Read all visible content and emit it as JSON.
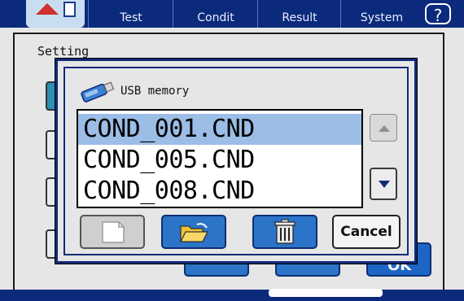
{
  "tabs": [
    {
      "label": "Test"
    },
    {
      "label": "Condit"
    },
    {
      "label": "Result"
    },
    {
      "label": "System"
    }
  ],
  "help": {
    "label": "?"
  },
  "panel": {
    "title": "Setting"
  },
  "bg_buttons": {
    "ok_label": "OK"
  },
  "dialog": {
    "title": "USB memory",
    "files": [
      "COND_001.CND",
      "COND_005.CND",
      "COND_008.CND"
    ],
    "selected_index": 0,
    "cancel_label": "Cancel"
  },
  "icons": {
    "home": "home-icon",
    "usb": "usb-drive-icon",
    "new": "new-document-icon",
    "open": "open-folder-icon",
    "delete": "trash-icon",
    "up": "arrow-up-icon",
    "down": "arrow-down-icon"
  },
  "colors": {
    "bar": "#0c2a7c",
    "selection": "#9bbde6",
    "button_blue": "#2b74c8"
  }
}
